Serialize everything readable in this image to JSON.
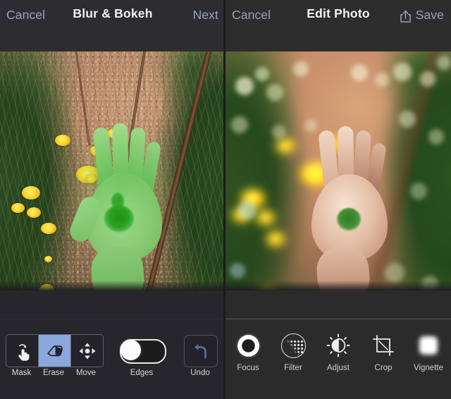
{
  "app": {
    "background": "#2b2b2b",
    "accent_blue": "#98a1c0",
    "selected_segment_blue": "#8ba7de",
    "mask_green": "#2aa321"
  },
  "left_panel": {
    "header": {
      "cancel_label": "Cancel",
      "title": "Blur & Bokeh",
      "next_label": "Next"
    },
    "photo": {
      "description": "hand over flowering weeds and soil with green selection mask on hand",
      "mask_active": true
    },
    "toolbar": {
      "segmented": {
        "selected": "Erase",
        "items": [
          {
            "label": "Mask",
            "icon": "hand-tap-icon",
            "selected": false
          },
          {
            "label": "Erase",
            "icon": "eraser-icon",
            "selected": true
          },
          {
            "label": "Move",
            "icon": "move-arrows-icon",
            "selected": false
          }
        ]
      },
      "edges": {
        "label": "Edges",
        "icon": "toggle-switch-icon",
        "value": "on"
      },
      "undo": {
        "label": "Undo",
        "icon": "undo-arrow-icon"
      }
    }
  },
  "right_panel": {
    "header": {
      "cancel_label": "Cancel",
      "title": "Edit Photo",
      "save_label": "Save",
      "share_icon": "share-upload-icon"
    },
    "photo": {
      "description": "same scene with bokeh blur applied to background, hand in focus",
      "blur_applied": true
    },
    "toolbar": {
      "items": [
        {
          "label": "Focus",
          "icon": "focus-ring-icon"
        },
        {
          "label": "Filter",
          "icon": "filter-halftone-icon"
        },
        {
          "label": "Adjust",
          "icon": "brightness-sun-icon"
        },
        {
          "label": "Crop",
          "icon": "crop-frame-icon"
        },
        {
          "label": "Vignette",
          "icon": "vignette-blob-icon"
        }
      ]
    }
  }
}
